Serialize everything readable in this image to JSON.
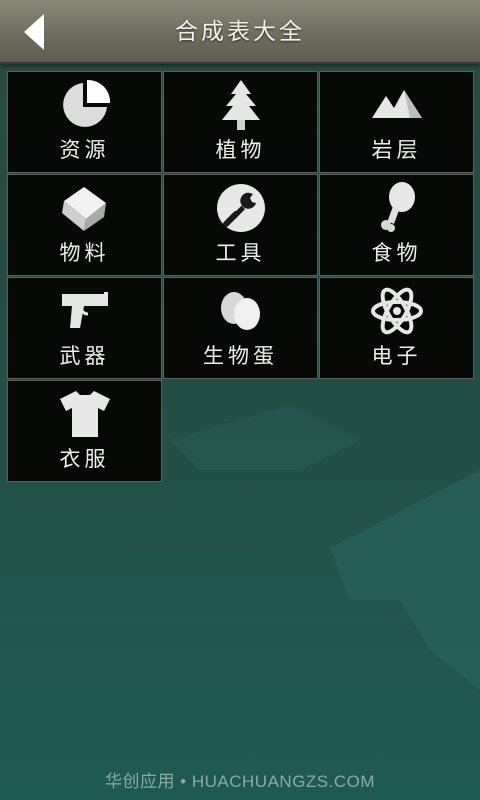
{
  "header": {
    "title": "合成表大全"
  },
  "categories": [
    {
      "label": "资源",
      "icon": "pie-chart-icon"
    },
    {
      "label": "植物",
      "icon": "tree-icon"
    },
    {
      "label": "岩层",
      "icon": "mountains-icon"
    },
    {
      "label": "物料",
      "icon": "block-icon"
    },
    {
      "label": "工具",
      "icon": "wrench-icon"
    },
    {
      "label": "食物",
      "icon": "drumstick-icon"
    },
    {
      "label": "武器",
      "icon": "pistol-icon"
    },
    {
      "label": "生物蛋",
      "icon": "eggs-icon"
    },
    {
      "label": "电子",
      "icon": "atom-icon"
    },
    {
      "label": "衣服",
      "icon": "tshirt-icon"
    }
  ],
  "footer": {
    "watermark": "华创应用 • HUACHUANGZS.COM"
  },
  "colors": {
    "header": "#6e6d5e",
    "cell": "#070907",
    "cell_border": "#5e5e5a",
    "background": "#234d45"
  }
}
